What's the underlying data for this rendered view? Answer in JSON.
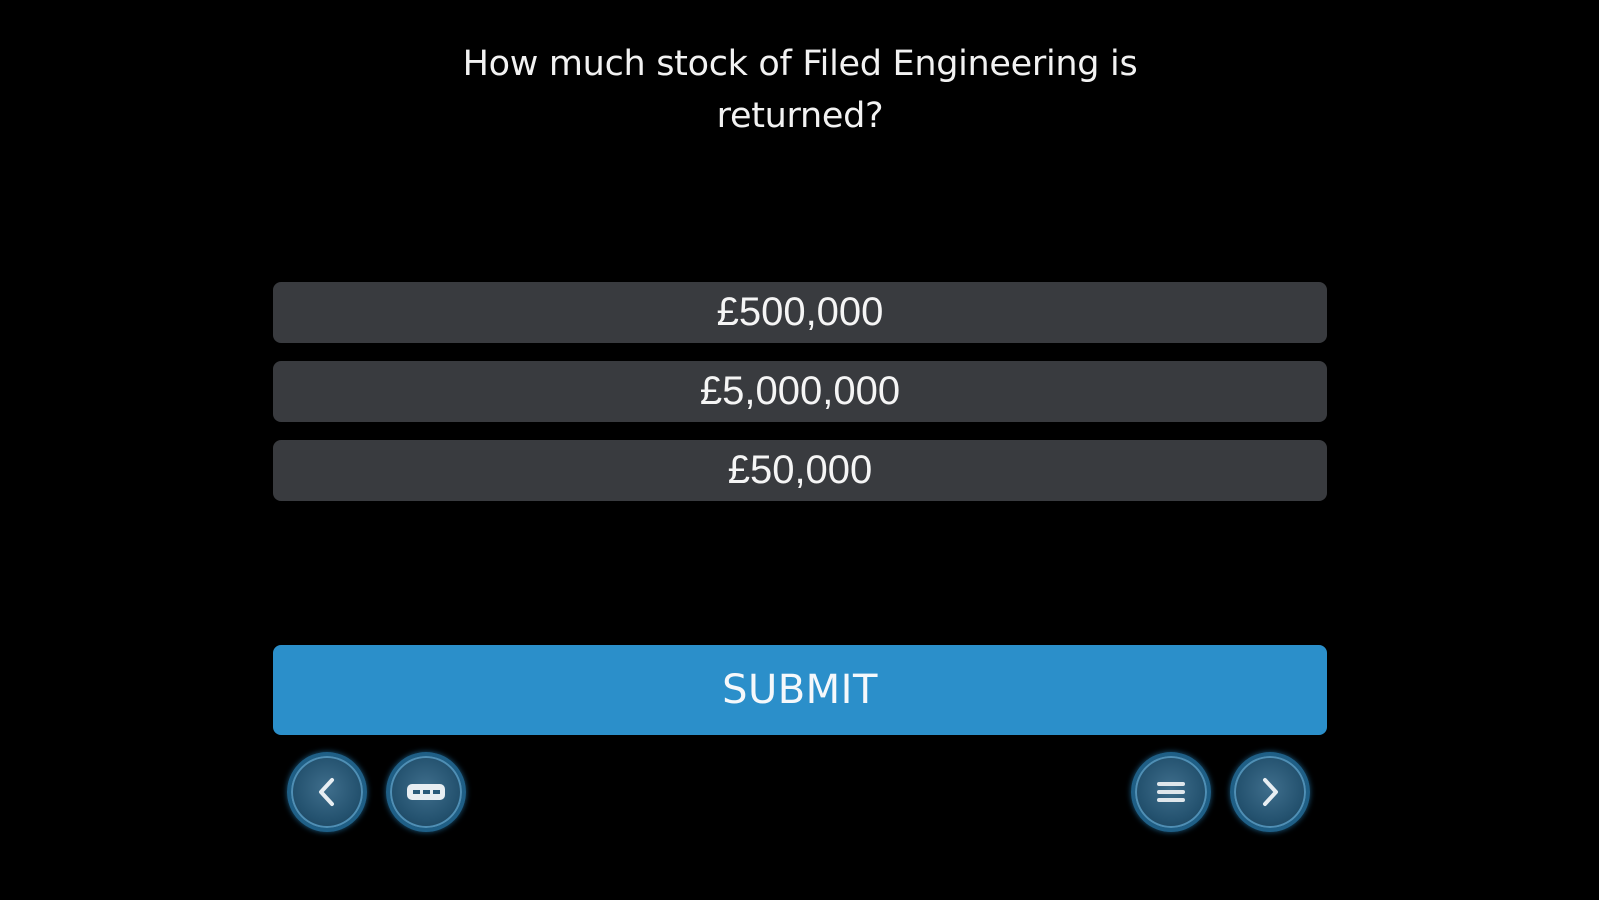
{
  "quiz": {
    "question": "How much stock of Filed Engineering is returned?",
    "options": [
      {
        "label": "£500,000"
      },
      {
        "label": "£5,000,000"
      },
      {
        "label": "£50,000"
      }
    ],
    "submit_label": "SUBMIT"
  },
  "nav": {
    "prev_icon": "chevron-left-icon",
    "captions_icon": "captions-icon",
    "menu_icon": "menu-icon",
    "next_icon": "chevron-right-icon"
  },
  "colors": {
    "background": "#000000",
    "option_bg": "#393b3f",
    "submit_bg": "#2b8fca",
    "nav_button": "#24526f"
  }
}
